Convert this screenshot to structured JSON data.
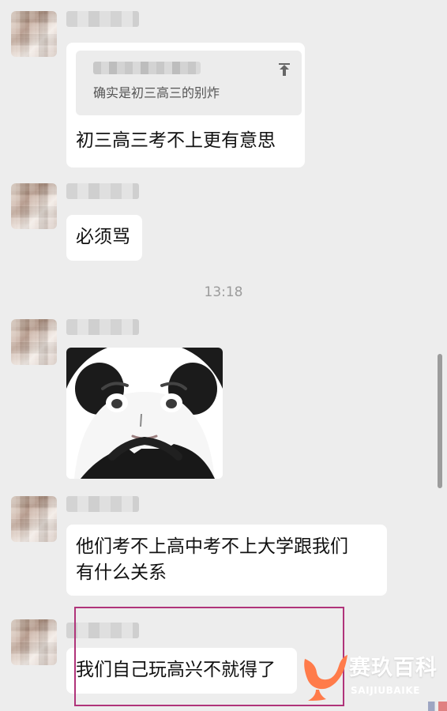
{
  "chat": {
    "messages": [
      {
        "quote": {
          "text": "确实是初三高三的别炸",
          "icon": "reply-up-icon"
        },
        "text": "初三高三考不上更有意思"
      },
      {
        "text": "必须骂"
      },
      {
        "timestamp": "13:18"
      },
      {
        "sticker": "panda-meme-sticker"
      },
      {
        "text": "他们考不上高中考不上大学跟我们\n有什么关系"
      },
      {
        "text": "我们自己玩高兴不就得了"
      }
    ]
  },
  "watermark": {
    "title": "赛玖百科",
    "subtitle": "SAIJIUBAIKE",
    "brand_color": "#ff7b4a"
  }
}
